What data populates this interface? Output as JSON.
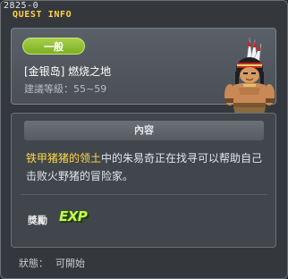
{
  "window": {
    "quest_id": "2825-0",
    "title": "QUEST INFO"
  },
  "header": {
    "category": "一般",
    "quest_name": "[金银岛] 燃烧之地",
    "req_level_label": "建議等級：",
    "req_level": "55~59"
  },
  "body": {
    "section_title": "內容",
    "desc_highlight": "铁甲猪猪的领土",
    "desc_rest": "中的朱易奇正在找寻可以帮助自己击败火野猪的冒险家。",
    "reward_label": "獎勵",
    "reward_exp": "EXP"
  },
  "status": {
    "label": "狀態：",
    "value": "可開始"
  },
  "colors": {
    "accent": "#ffd24a",
    "badge_green": "#8dbd2e",
    "highlight": "#ffd844",
    "exp": "#c8f25a"
  },
  "icons": [
    "npc-warrior-icon",
    "exp-icon"
  ]
}
